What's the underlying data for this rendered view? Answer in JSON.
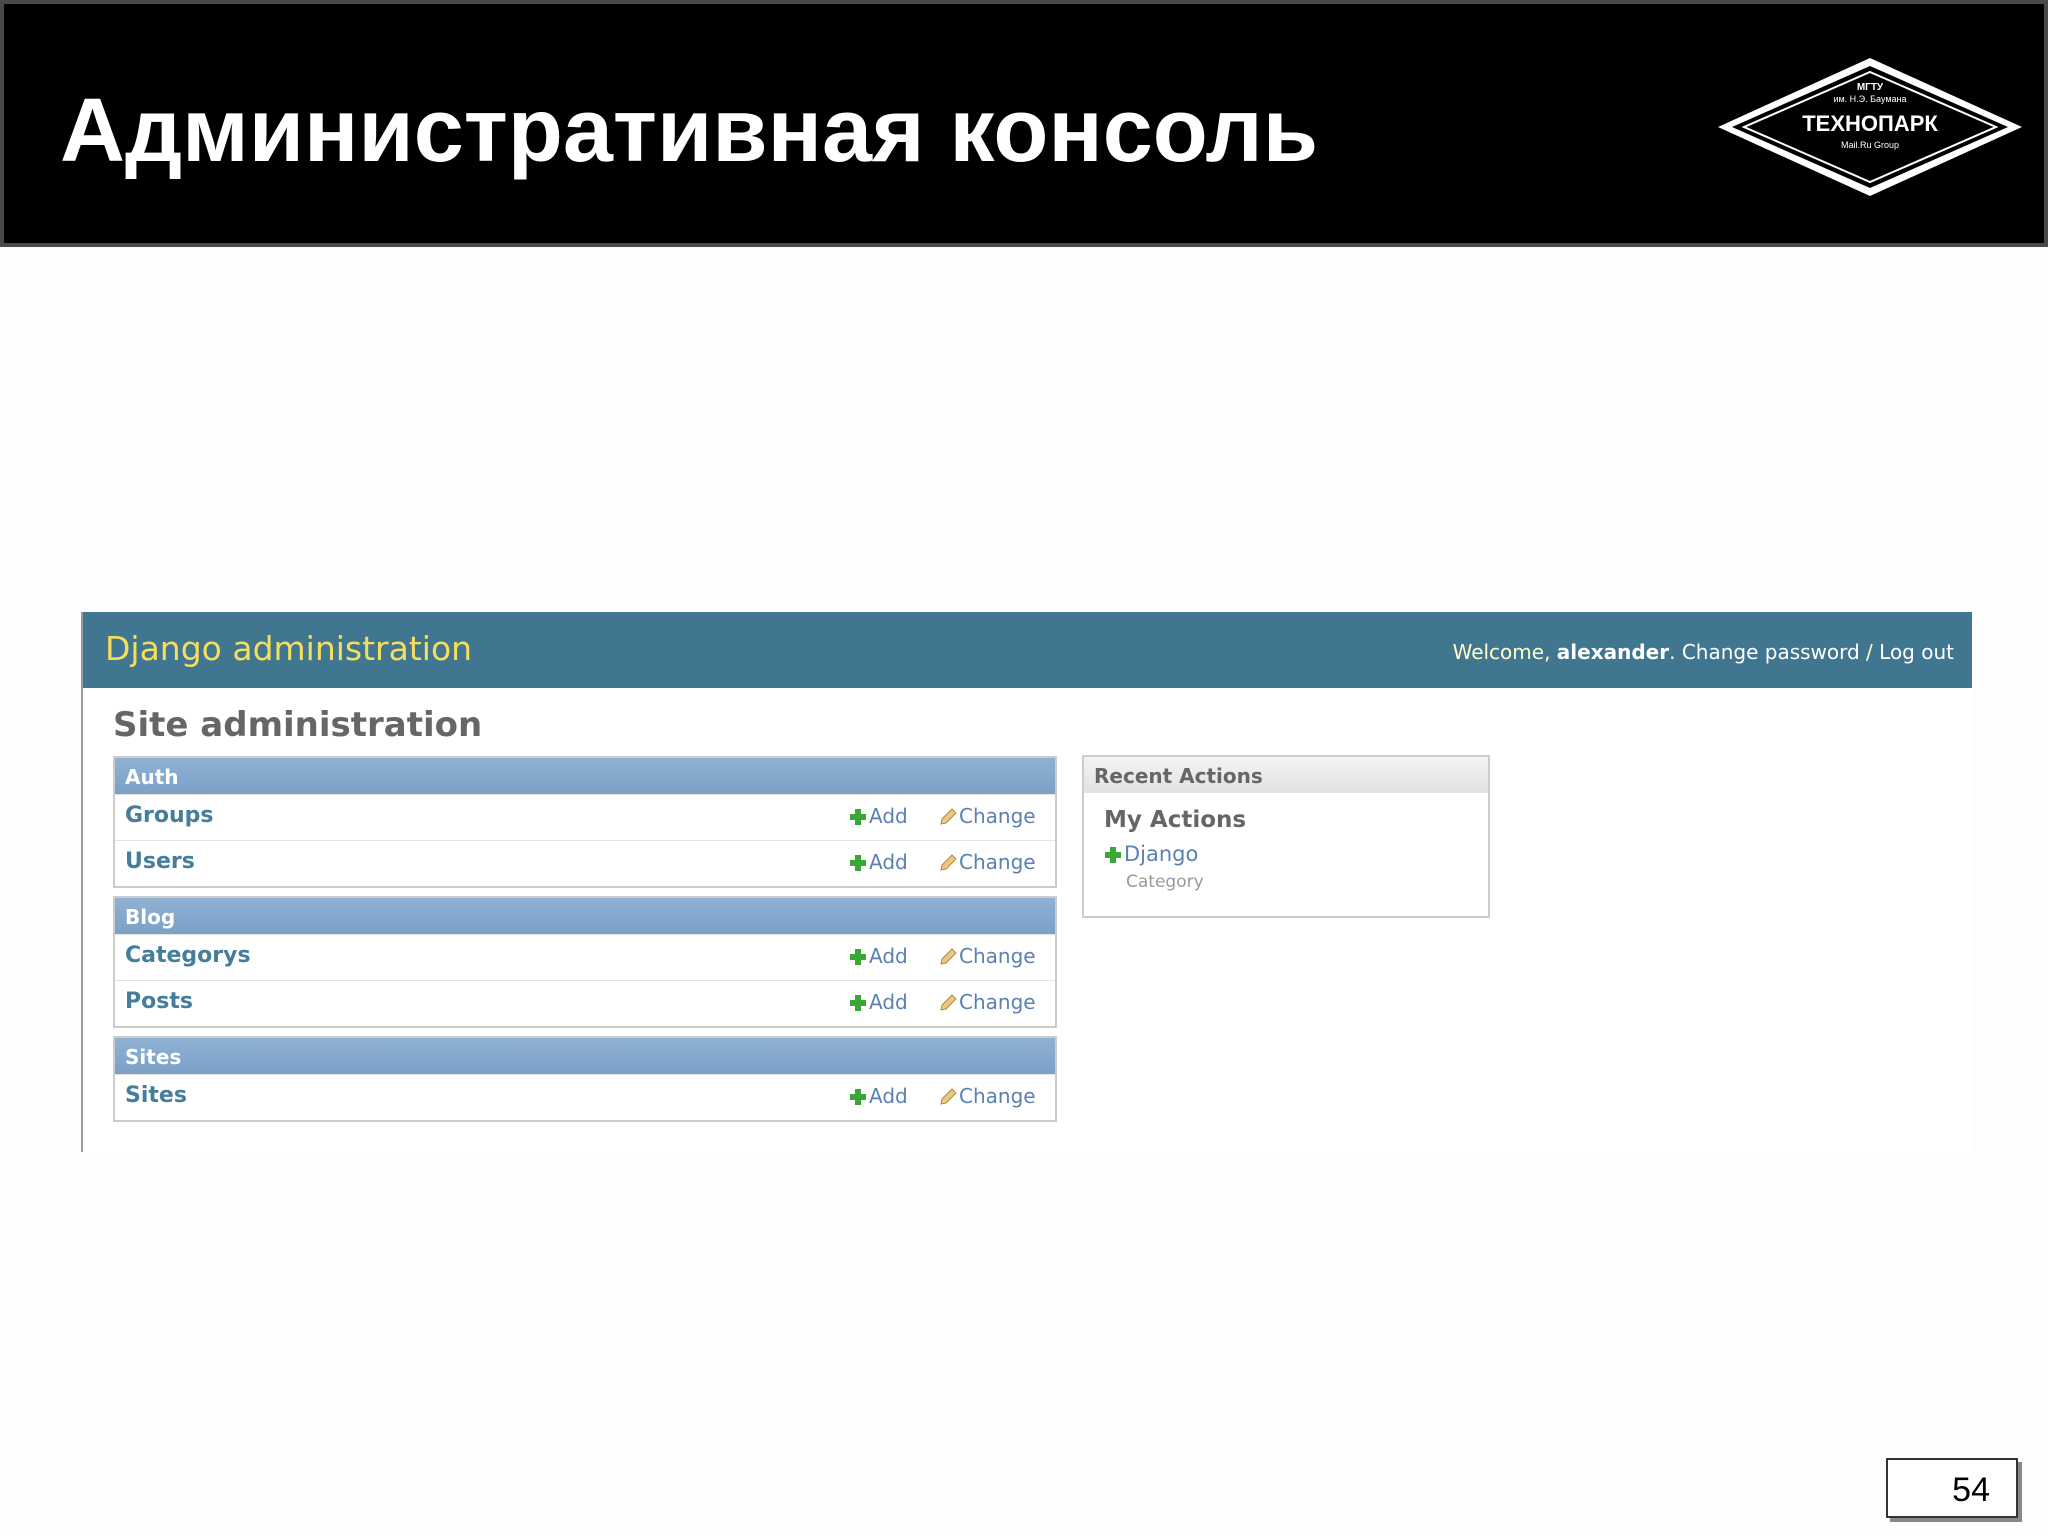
{
  "slide": {
    "title": "Административная консоль",
    "page_number": "54",
    "logo": {
      "line1": "МГТУ",
      "line2": "им. Н.Э. Баумана",
      "line3": "ТЕХНОПАРК",
      "line4": "Mail.Ru Group"
    }
  },
  "django": {
    "branding": "Django administration",
    "usertools": {
      "welcome": "Welcome, ",
      "username": "alexander",
      "after_user": ". ",
      "change_password": "Change password",
      "separator": " / ",
      "logout": "Log out"
    },
    "site_title": "Site administration",
    "add_label": "Add",
    "change_label": "Change",
    "modules": [
      {
        "caption": "Auth",
        "rows": [
          "Groups",
          "Users"
        ]
      },
      {
        "caption": "Blog",
        "rows": [
          "Categorys",
          "Posts"
        ]
      },
      {
        "caption": "Sites",
        "rows": [
          "Sites"
        ]
      }
    ],
    "recent_actions": {
      "caption": "Recent Actions",
      "subtitle": "My Actions",
      "item": "Django",
      "item_type": "Category"
    },
    "colors": {
      "header_bg": "#417690",
      "branding": "#f5dd5d",
      "module_caption": "#7ca0c7",
      "link": "#447e9b",
      "add_icon": "#3aa836"
    }
  }
}
